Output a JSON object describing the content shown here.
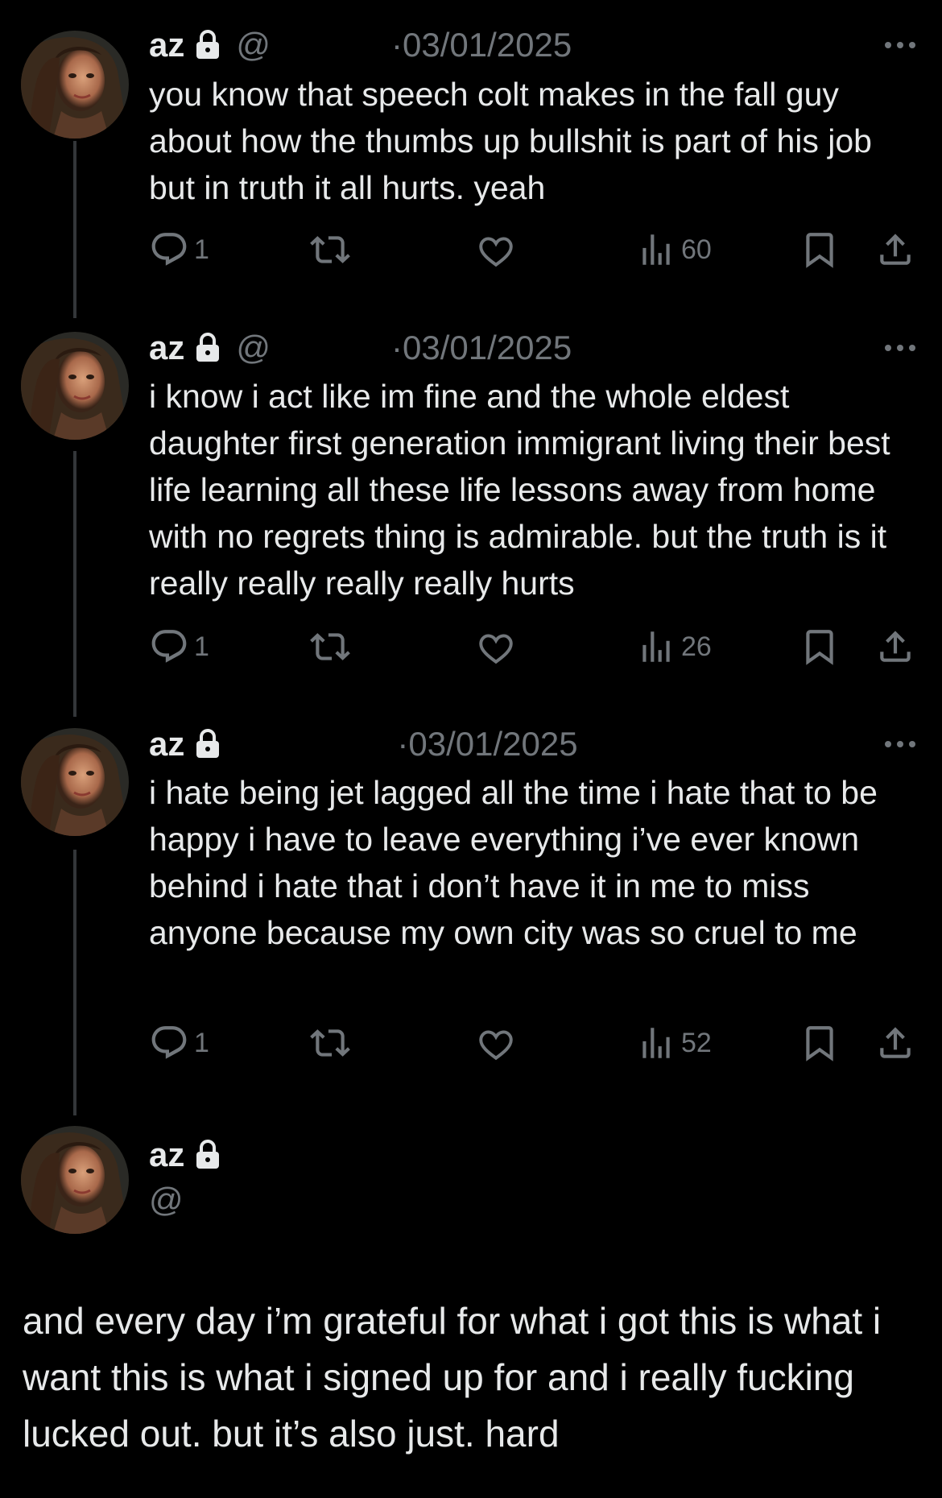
{
  "tweets": [
    {
      "name": "az",
      "handle_prefix": "@",
      "date": "·03/01/2025",
      "text": "you know that speech colt makes in the fall guy about how the thumbs up bullshit is part of his job but in truth it all hurts. yeah",
      "replies": "1",
      "views": "60"
    },
    {
      "name": "az",
      "handle_prefix": "@",
      "date": "·03/01/2025",
      "text": "i know i act like im fine and the whole eldest daughter first generation immigrant living their best life learning all these life lessons away from home with no regrets thing is admirable. but the truth is it really really really really hurts",
      "replies": "1",
      "views": "26"
    },
    {
      "name": "az",
      "handle_prefix": "",
      "date": "·03/01/2025",
      "text": "i hate being jet lagged all the time i hate that to be happy i have to leave everything i’ve ever known behind i hate that i don’t have it in me to miss anyone because my own city was so cruel to me",
      "replies": "1",
      "views": "52"
    }
  ],
  "final": {
    "name": "az",
    "handle_prefix": "@",
    "text": "and every day i’m grateful for what i got this is what i want this is what i signed up for and i really fucking lucked out. but it’s also just. hard"
  },
  "icons": {
    "lock": "lock-icon",
    "more": "more-icon",
    "reply": "reply-icon",
    "retweet": "retweet-icon",
    "like": "heart-icon",
    "views": "views-icon",
    "bookmark": "bookmark-icon",
    "share": "share-icon"
  },
  "colors": {
    "background": "#000000",
    "text": "#e7e9ea",
    "muted": "#71767b",
    "thread_line": "#333639"
  }
}
